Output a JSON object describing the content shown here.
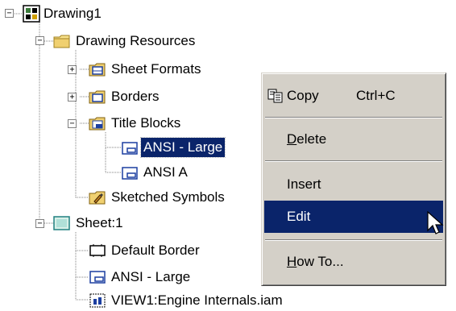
{
  "tree": {
    "root": {
      "label": "Drawing1",
      "icon": "drawing-icon"
    },
    "items": [
      {
        "label": "Drawing Resources",
        "icon": "folder-icon"
      },
      {
        "label": "Sheet Formats",
        "icon": "sheet-format-folder-icon"
      },
      {
        "label": "Borders",
        "icon": "borders-folder-icon"
      },
      {
        "label": "Title Blocks",
        "icon": "title-blocks-folder-icon"
      },
      {
        "label": "ANSI - Large",
        "icon": "title-block-icon"
      },
      {
        "label": "ANSI A",
        "icon": "title-block-icon"
      },
      {
        "label": "Sketched Symbols",
        "icon": "sketched-symbols-folder-icon"
      },
      {
        "label": "Sheet:1",
        "icon": "sheet-icon"
      },
      {
        "label": "Default Border",
        "icon": "border-icon"
      },
      {
        "label": "ANSI - Large",
        "icon": "title-block-icon"
      },
      {
        "label": "VIEW1:Engine Internals.iam",
        "icon": "view-icon"
      }
    ],
    "expanders": {
      "collapsed": "+",
      "expanded": "−"
    }
  },
  "context_menu": {
    "copy": {
      "label": "Copy",
      "shortcut": "Ctrl+C"
    },
    "delete": {
      "label_u": "D",
      "label_rest": "elete"
    },
    "insert": {
      "label": "Insert"
    },
    "edit": {
      "label": "Edit"
    },
    "how_to": {
      "label_u": "H",
      "label_rest": "ow To..."
    }
  },
  "colors": {
    "selection": "#0a246a",
    "menu_bg": "#d4d0c8",
    "folder": "#f0d070"
  }
}
